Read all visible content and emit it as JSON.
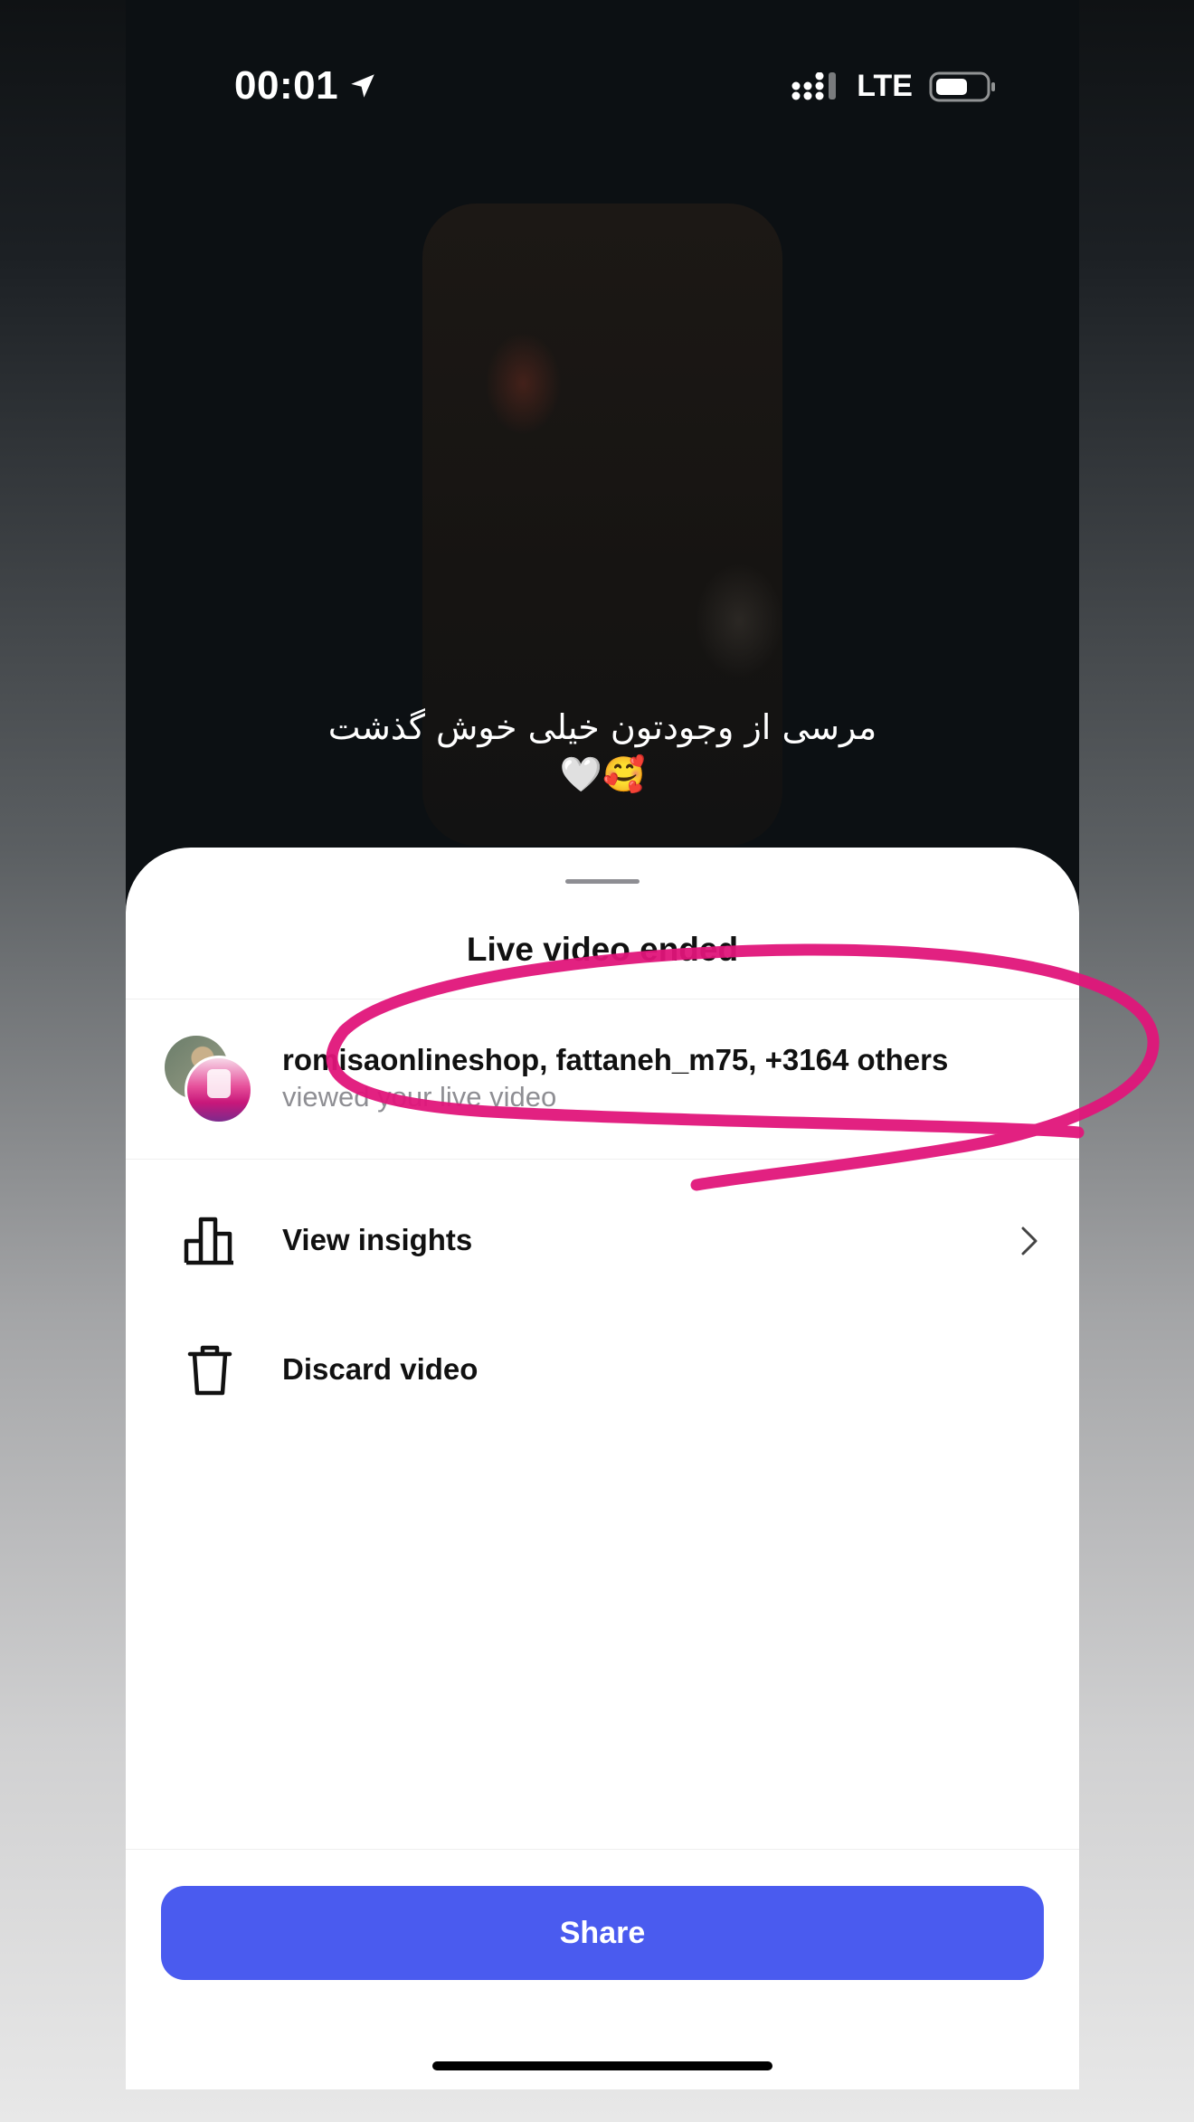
{
  "status_bar": {
    "time": "00:01",
    "network": "LTE",
    "icons": [
      "location-arrow-icon",
      "signal-icon",
      "battery-icon"
    ]
  },
  "stream": {
    "caption_line1": "مرسی از وجودتون خیلی خوش گذشت",
    "caption_line2": "🤍🥰"
  },
  "sheet": {
    "title": "Live video ended",
    "viewers": {
      "names": "romisaonlineshop, fattaneh_m75, +3164 others",
      "subtitle": "viewed your live video"
    },
    "menu": [
      {
        "label": "View insights",
        "icon": "bar-chart-icon"
      },
      {
        "label": "Discard video",
        "icon": "trash-icon"
      }
    ],
    "share_label": "Share"
  },
  "colors": {
    "accent": "#4a5bef",
    "annotation": "#e0157a"
  }
}
